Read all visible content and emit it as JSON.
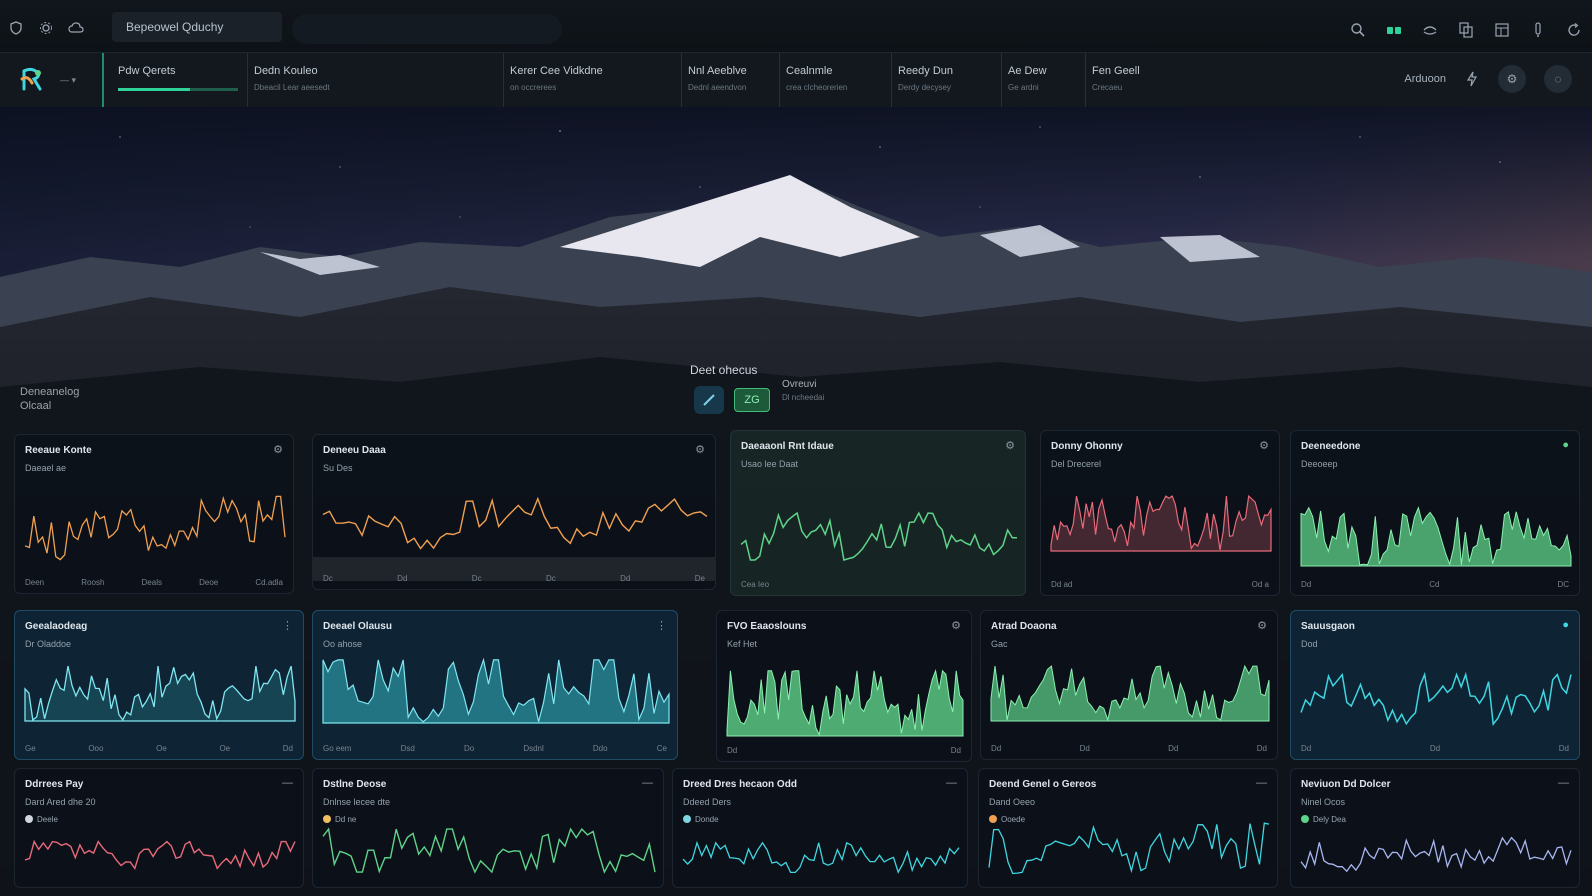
{
  "window": {
    "title": "Bepeowel Qduchy"
  },
  "nav": {
    "tabs": [
      {
        "title": "Pdw Qerets",
        "sub": "",
        "progress": 0.6
      },
      {
        "title": "Dedn Kouleo",
        "sub": "Dbeacil Lear aeesedt"
      },
      {
        "title": "Kerer Cee Vidkdne",
        "sub": "on occrerees"
      },
      {
        "title": "Nnl Aeeblve",
        "sub": "Dednl aeendvon"
      },
      {
        "title": "Cealnmle",
        "sub": "crea clcheorerien"
      },
      {
        "title": "Reedy Dun",
        "sub": "Derdy decysey"
      },
      {
        "title": "Ae Dew",
        "sub": "Ge ardni"
      },
      {
        "title": "Fen Geell",
        "sub": "Crecaeu"
      }
    ],
    "right_label": "Arduoon"
  },
  "hero": {
    "left_title": "Deneanelog",
    "left_sub": "Olcaal",
    "center_label": "Deet ohecus",
    "center_desc_title": "Ovreuvi",
    "center_desc_sub": "Dl ncheedai",
    "btn_b": "ZG"
  },
  "panels": [
    {
      "title": "Reeaue Konte",
      "sub": "Daeael ae",
      "menu": "⚙",
      "ticks": [
        "Deen",
        "Roosh",
        "Deals",
        "Deoe",
        "Cd.adla"
      ]
    },
    {
      "title": "Deneeu Daaa",
      "sub": "Su Des",
      "menu": "⚙",
      "ticks": [
        "Dc",
        "Dd",
        "Dc",
        "Dc",
        "Dd",
        "De"
      ]
    },
    {
      "title": "Daeaaonl Rnt Idaue",
      "sub": "Usao lee Daat",
      "menu": "⚙",
      "ticks": [
        "Cea Ieo"
      ]
    },
    {
      "title": "Donny Ohonny",
      "sub": "Del Drecerel",
      "menu": "⚙",
      "ticks": [
        "Dd ad",
        "Od a"
      ]
    },
    {
      "title": "Deeneedone",
      "sub": "Deeoeep",
      "menu": "●",
      "ticks": [
        "Dd",
        "Cd",
        "DC"
      ]
    },
    {
      "title": "Geealaodeag",
      "sub": "Dr Oladdoe",
      "menu": "⋮",
      "ticks": [
        "Ge",
        "Ooo",
        "Oe",
        "Oe",
        "Dd"
      ]
    },
    {
      "title": "Deeael Olausu",
      "sub": "Oo ahose",
      "menu": "⋮",
      "ticks": [
        "Go eem",
        "Dsd",
        "Do",
        "Dsdnl",
        "Ddo",
        "Ce"
      ]
    },
    {
      "title": "FVO Eaaoslouns",
      "sub": "Kef Het",
      "menu": "⚙",
      "ticks": [
        "Dd",
        "Dd"
      ]
    },
    {
      "title": "Atrad Doaona",
      "sub": "Gac",
      "menu": "⚙",
      "ticks": [
        "Dd",
        "Dd",
        "Dd",
        "Dd"
      ]
    },
    {
      "title": "Sauusgaon",
      "sub": "Dod",
      "menu": "●",
      "ticks": [
        "Dd",
        "Dd",
        "Dd"
      ]
    },
    {
      "title": "Ddrrees Pay",
      "sub": "Dard Ared dhe 20",
      "menu": "—",
      "item": "Deele"
    },
    {
      "title": "Dstlne Deose",
      "sub": "Dnlnse lecee dte",
      "menu": "—",
      "item": "Dd ne"
    },
    {
      "title": "Dreed Dres hecaon Odd",
      "sub": "Ddeed Ders",
      "menu": "—",
      "item": "Donde"
    },
    {
      "title": "Deend Genel o Gereos",
      "sub": "Dand Oeeo",
      "menu": "—",
      "item": "Ooede"
    },
    {
      "title": "Neviuon Dd Dolcer",
      "sub": "Ninel Ocos",
      "menu": "—",
      "item": "Dely Dea"
    }
  ],
  "colors": {
    "accent": "#2fd39a",
    "orange": "#f0a050",
    "green": "#5fd38a",
    "teal": "#3fd6e0",
    "red": "#e86a7a",
    "lavender": "#a9b6f0"
  },
  "icons": [
    "shield-icon",
    "gear-icon",
    "cloud-icon",
    "search-icon",
    "status-icon",
    "sync-icon",
    "copy-icon",
    "layout-icon",
    "info-icon",
    "refresh-icon"
  ]
}
